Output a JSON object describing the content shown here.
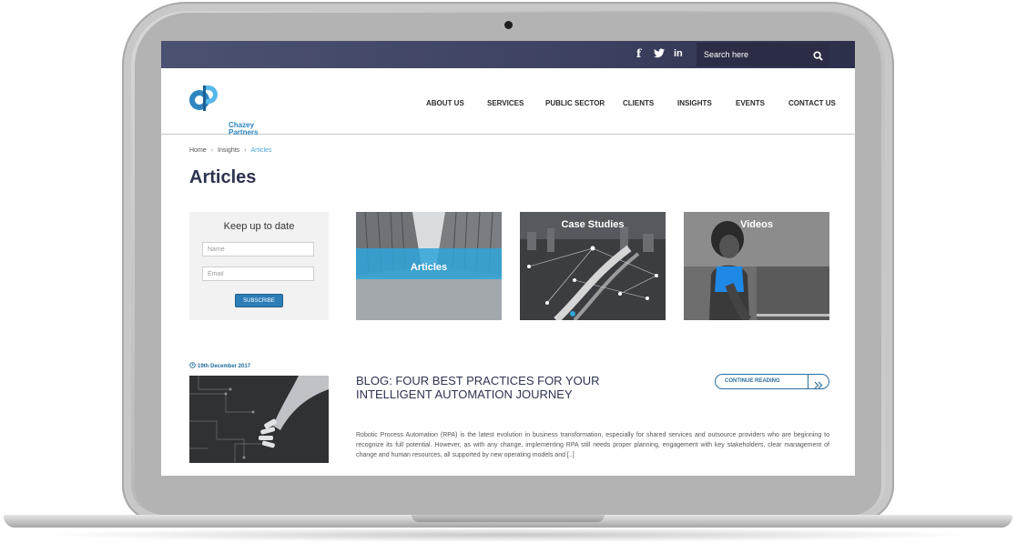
{
  "topbar": {
    "social": [
      {
        "name": "facebook-icon",
        "glyph": "f"
      },
      {
        "name": "twitter-icon",
        "glyph": "🐦"
      },
      {
        "name": "linkedin-icon",
        "glyph": "in"
      }
    ],
    "search_placeholder": "Search here"
  },
  "header": {
    "logo_line1": "Chazey",
    "logo_line2": "Partners",
    "nav": [
      "ABOUT US",
      "SERVICES",
      "PUBLIC SECTOR",
      "CLIENTS",
      "INSIGHTS",
      "EVENTS",
      "CONTACT US"
    ]
  },
  "breadcrumb": [
    "Home",
    "Insights",
    "Articles"
  ],
  "page_title": "Articles",
  "newsletter": {
    "title": "Keep up to date",
    "name_placeholder": "Name",
    "email_placeholder": "Email",
    "subscribe_label": "SUBSCRIBE"
  },
  "tiles": [
    {
      "label": "Articles"
    },
    {
      "label": "Case Studies"
    },
    {
      "label": "Videos"
    }
  ],
  "post": {
    "date": "19th December 2017",
    "title": "BLOG: FOUR BEST PRACTICES FOR YOUR INTELLIGENT AUTOMATION JOURNEY",
    "continue_label": "CONTINUE READING",
    "excerpt": "Robotic Process Automation (RPA) is the latest evolution in business transformation, especially for shared services and outsource providers who are beginning to recognize its full potential. However, as with any change, implementing RPA still needs proper planning, engagement with key stakeholders, clear management of change and human resources, all supported by new operating models and [..]"
  },
  "colors": {
    "topbar": "#3c4260",
    "brand_blue": "#2c7db8",
    "title_navy": "#2e3350",
    "tile_teal": "#2fa4d8"
  }
}
